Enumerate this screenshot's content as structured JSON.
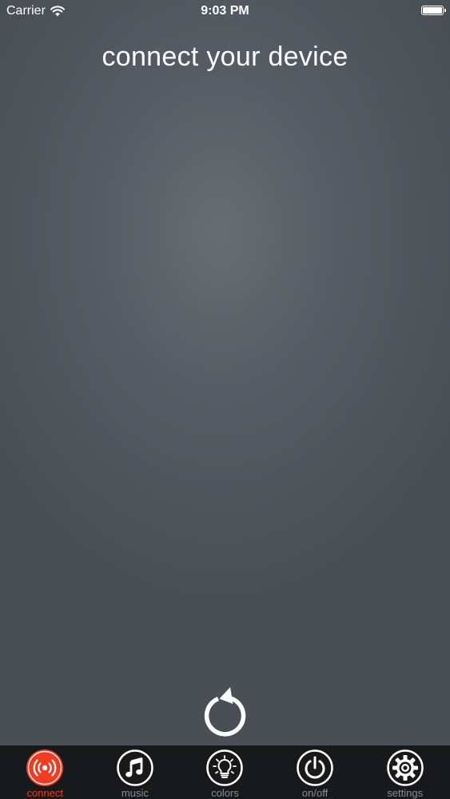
{
  "status_bar": {
    "carrier": "Carrier",
    "time": "9:03 PM",
    "wifi_icon": "wifi-icon",
    "battery_icon": "battery-icon"
  },
  "main": {
    "title": "connect your device",
    "refresh_icon": "refresh-icon"
  },
  "tab_bar": {
    "active_color": "#ef3b1f",
    "inactive_color": "#8a8d91",
    "items": [
      {
        "label": "connect",
        "icon": "broadcast-icon",
        "active": true
      },
      {
        "label": "music",
        "icon": "music-note-icon",
        "active": false
      },
      {
        "label": "colors",
        "icon": "light-bulb-icon",
        "active": false
      },
      {
        "label": "on/off",
        "icon": "power-icon",
        "active": false
      },
      {
        "label": "settings",
        "icon": "gear-icon",
        "active": false
      }
    ]
  }
}
